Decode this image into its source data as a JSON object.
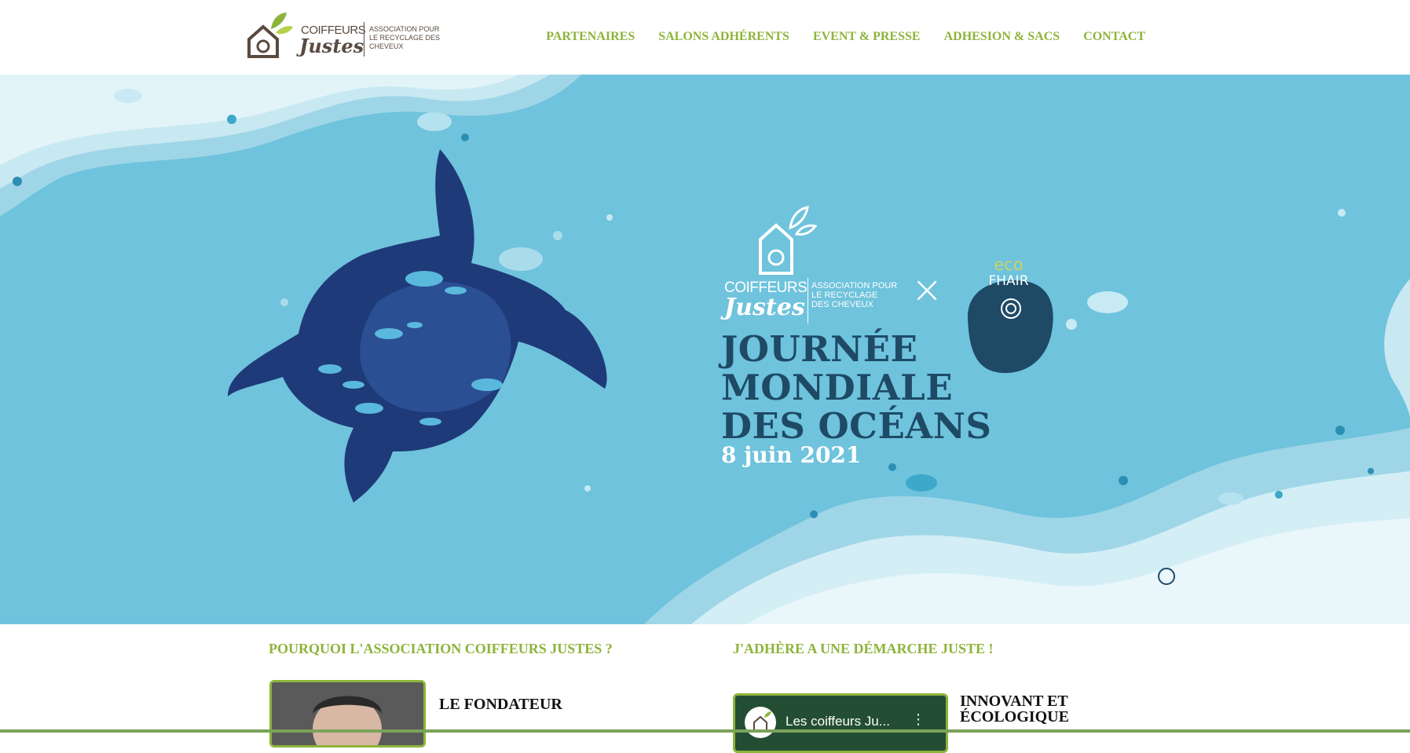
{
  "logo": {
    "line1": "COIFFEURS",
    "line2": "Justes",
    "assoc": "ASSOCIATION POUR LE RECYCLAGE DES CHEVEUX"
  },
  "nav": {
    "items": [
      {
        "label": "PARTENAIRES"
      },
      {
        "label": "SALONS ADHÉRENTS"
      },
      {
        "label": "EVENT & PRESSE"
      },
      {
        "label": "ADHESION & SACS"
      },
      {
        "label": "CONTACT"
      }
    ]
  },
  "hero": {
    "logo_line1": "COIFFEURS",
    "logo_line2": "Justes",
    "logo_assoc": "ASSOCIATION POUR LE RECYCLAGE DES CHEVEUX",
    "cross": "×",
    "partner_line1": "eco",
    "partner_line2": "FHAIR",
    "title_line1": "JOURNÉE",
    "title_line2": "MONDIALE",
    "title_line3": "DES OCÉANS",
    "date": "8 juin 2021"
  },
  "sections": {
    "left_heading": "POURQUOI L'ASSOCIATION COIFFEURS JUSTES ?",
    "right_heading": "J'ADHÈRE A UNE DÉMARCHE JUSTE !",
    "founder_title": "LE FONDATEUR",
    "video_title": "Les coiffeurs Ju...",
    "video_menu": "⋮",
    "innov_line1": "INNOVANT ET",
    "innov_line2": "ÉCOLOGIQUE"
  },
  "colors": {
    "accent": "#8db43a",
    "ocean": "#6fc3dc",
    "navy": "#1e4a66"
  }
}
